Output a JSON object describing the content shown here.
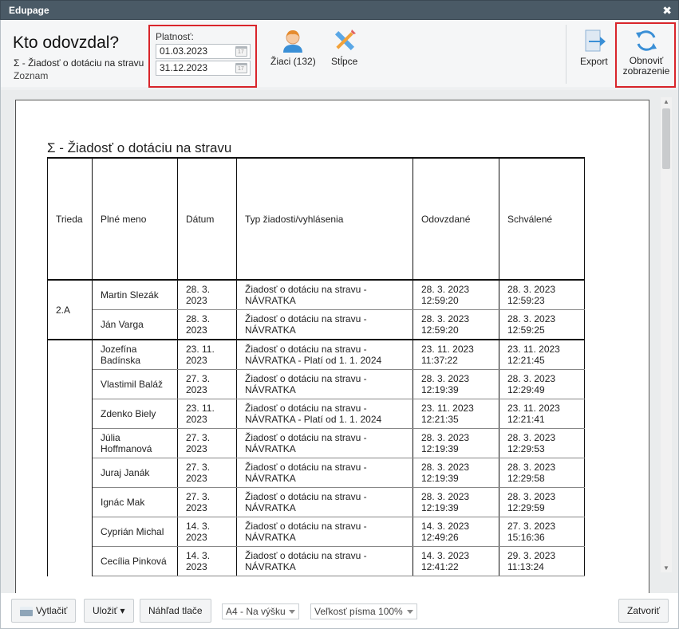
{
  "window": {
    "title": "Edupage",
    "close": "✖"
  },
  "header": {
    "title": "Kto odovzdal?",
    "subtitle": "Σ - Žiadosť o dotáciu na stravu",
    "view": "Zoznam"
  },
  "validity": {
    "label": "Platnosť:",
    "from": "01.03.2023",
    "to": "31.12.2023"
  },
  "toolbar": {
    "students_label": "Žiaci (132)",
    "columns_label": "Stĺpce",
    "export_label": "Export",
    "refresh_line1": "Obnoviť",
    "refresh_line2": "zobrazenie"
  },
  "report": {
    "title": "Σ - Žiadosť o dotáciu na stravu",
    "columns": [
      "Trieda",
      "Plné meno",
      "Dátum",
      "Typ žiadosti/vyhlásenia",
      "Odovzdané",
      "Schválené"
    ],
    "rows": [
      {
        "cls": "2.A",
        "name": [
          "Martin Slezák"
        ],
        "date": [
          "28. 3.",
          "2023"
        ],
        "type": [
          "Žiadosť o dotáciu na stravu -",
          "NÁVRATKA"
        ],
        "sub": [
          "28. 3. 2023",
          "12:59:20"
        ],
        "appr": [
          "28. 3. 2023",
          "12:59:23"
        ]
      },
      {
        "cls": "",
        "name": [
          "Ján Varga"
        ],
        "date": [
          "28. 3.",
          "2023"
        ],
        "type": [
          "Žiadosť o dotáciu na stravu -",
          "NÁVRATKA"
        ],
        "sub": [
          "28. 3. 2023",
          "12:59:20"
        ],
        "appr": [
          "28. 3. 2023",
          "12:59:25"
        ]
      },
      {
        "cls": "",
        "name": [
          "Jozefína",
          "Badínska"
        ],
        "date": [
          "23. 11.",
          "2023"
        ],
        "type": [
          "Žiadosť o dotáciu na stravu -",
          "NÁVRATKA - Platí od 1. 1. 2024"
        ],
        "sub": [
          "23. 11. 2023",
          "11:37:22"
        ],
        "appr": [
          "23. 11. 2023",
          "12:21:45"
        ]
      },
      {
        "cls": "",
        "name": [
          "Vlastimil Baláž"
        ],
        "date": [
          "27. 3.",
          "2023"
        ],
        "type": [
          "Žiadosť o dotáciu na stravu -",
          "NÁVRATKA"
        ],
        "sub": [
          "28. 3. 2023",
          "12:19:39"
        ],
        "appr": [
          "28. 3. 2023",
          "12:29:49"
        ]
      },
      {
        "cls": "",
        "name": [
          "Zdenko Biely"
        ],
        "date": [
          "23. 11.",
          "2023"
        ],
        "type": [
          "Žiadosť o dotáciu na stravu -",
          "NÁVRATKA - Platí od 1. 1. 2024"
        ],
        "sub": [
          "23. 11. 2023",
          "12:21:35"
        ],
        "appr": [
          "23. 11. 2023",
          "12:21:41"
        ]
      },
      {
        "cls": "",
        "name": [
          "Júlia",
          "Hoffmanová"
        ],
        "date": [
          "27. 3.",
          "2023"
        ],
        "type": [
          "Žiadosť o dotáciu na stravu -",
          "NÁVRATKA"
        ],
        "sub": [
          "28. 3. 2023",
          "12:19:39"
        ],
        "appr": [
          "28. 3. 2023",
          "12:29:53"
        ]
      },
      {
        "cls": "",
        "name": [
          "Juraj Janák"
        ],
        "date": [
          "27. 3.",
          "2023"
        ],
        "type": [
          "Žiadosť o dotáciu na stravu -",
          "NÁVRATKA"
        ],
        "sub": [
          "28. 3. 2023",
          "12:19:39"
        ],
        "appr": [
          "28. 3. 2023",
          "12:29:58"
        ]
      },
      {
        "cls": "",
        "name": [
          "Ignác Mak"
        ],
        "date": [
          "27. 3.",
          "2023"
        ],
        "type": [
          "Žiadosť o dotáciu na stravu -",
          "NÁVRATKA"
        ],
        "sub": [
          "28. 3. 2023",
          "12:19:39"
        ],
        "appr": [
          "28. 3. 2023",
          "12:29:59"
        ]
      },
      {
        "cls": "",
        "name": [
          "Cyprián Michal"
        ],
        "date": [
          "14. 3.",
          "2023"
        ],
        "type": [
          "Žiadosť o dotáciu na stravu -",
          "NÁVRATKA"
        ],
        "sub": [
          "14. 3. 2023",
          "12:49:26"
        ],
        "appr": [
          "27. 3. 2023",
          "15:16:36"
        ]
      },
      {
        "cls": "",
        "name": [
          "Cecília Pinková"
        ],
        "date": [
          "14. 3.",
          "2023"
        ],
        "type": [
          "Žiadosť o dotáciu na stravu -",
          "NÁVRATKA"
        ],
        "sub": [
          "14. 3. 2023",
          "12:41:22"
        ],
        "appr": [
          "29. 3. 2023",
          "11:13:24"
        ]
      }
    ]
  },
  "footer": {
    "print_label": "Vytlačiť",
    "save_label": "Uložiť ▾",
    "preview_label": "Náhľad tlače",
    "paper_select": "A4 - Na výšku",
    "font_select": "Veľkosť písma 100%",
    "close_label": "Zatvoriť"
  },
  "colors": {
    "titlebar": "#4a5a66",
    "highlight": "#d9252b",
    "accent": "#3a8fd6"
  }
}
